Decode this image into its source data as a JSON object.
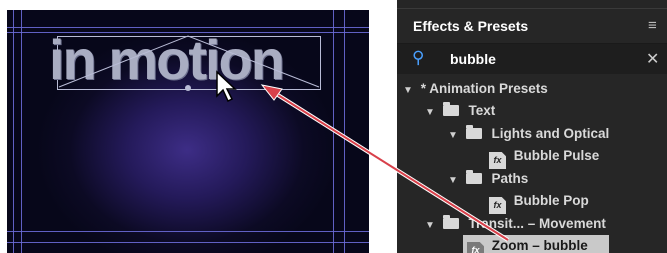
{
  "composition": {
    "title_text": "in motion"
  },
  "panel": {
    "title": "Effects & Presets",
    "menu_icon": "hamburger-menu-icon",
    "search": {
      "value": "bubble",
      "icon": "search-icon",
      "clear_icon": "close-icon"
    },
    "tree": [
      {
        "label": "* Animation Presets",
        "type": "folder-root",
        "expanded": true
      },
      {
        "label": "Text",
        "type": "folder",
        "expanded": true
      },
      {
        "label": "Lights and Optical",
        "type": "folder",
        "expanded": true
      },
      {
        "label": "Bubble Pulse",
        "type": "preset"
      },
      {
        "label": "Paths",
        "type": "folder",
        "expanded": true
      },
      {
        "label": "Bubble Pop",
        "type": "preset"
      },
      {
        "label": "Transit... – Movement",
        "type": "folder",
        "expanded": true
      },
      {
        "label": "Zoom – bubble",
        "type": "preset",
        "selected": true
      }
    ]
  },
  "colors": {
    "panel_bg": "#262626",
    "selection_bg": "#c9c9c9",
    "search_icon": "#4aa0ff",
    "guide_lines": "#6a6ad6",
    "arrow": "#d8404a"
  }
}
